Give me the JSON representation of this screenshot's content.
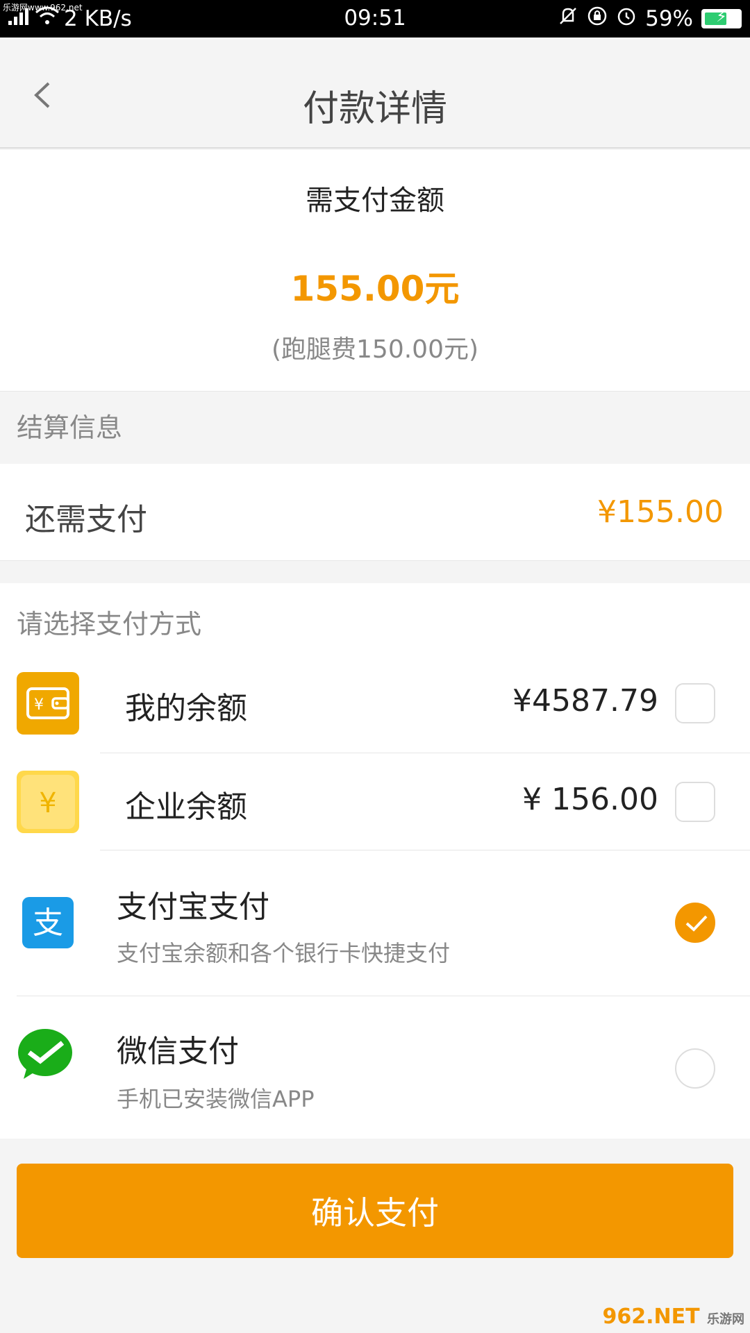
{
  "status_bar": {
    "network_speed": "2 KB/s",
    "time": "09:51",
    "battery_percent": "59%",
    "battery_level": 0.59,
    "watermark": "乐游网www.962.net"
  },
  "nav": {
    "title": "付款详情"
  },
  "amount": {
    "label": "需支付金额",
    "value": "155.00元",
    "sub": "(跑腿费150.00元)"
  },
  "settlement": {
    "header": "结算信息",
    "remaining_label": "还需支付",
    "remaining_value": "¥155.00"
  },
  "payment": {
    "header": "请选择支付方式",
    "methods": [
      {
        "name": "我的余额",
        "price": "¥4587.79",
        "icon": "wallet-icon",
        "selected": false
      },
      {
        "name": "企业余额",
        "price": "¥ 156.00",
        "icon": "yen-coin-icon",
        "selected": false
      },
      {
        "name": "支付宝支付",
        "desc": "支付宝余额和各个银行卡快捷支付",
        "icon": "alipay-icon",
        "selected": true
      },
      {
        "name": "微信支付",
        "desc": "手机已安装微信APP",
        "icon": "wechat-icon",
        "selected": false
      }
    ]
  },
  "confirm_label": "确认支付",
  "footer_watermark": {
    "brand": "962.NET",
    "sub": "乐游网"
  },
  "colors": {
    "accent": "#f39700",
    "alipay": "#1a9be6",
    "wechat": "#1aad19",
    "wallet": "#f0a800"
  }
}
